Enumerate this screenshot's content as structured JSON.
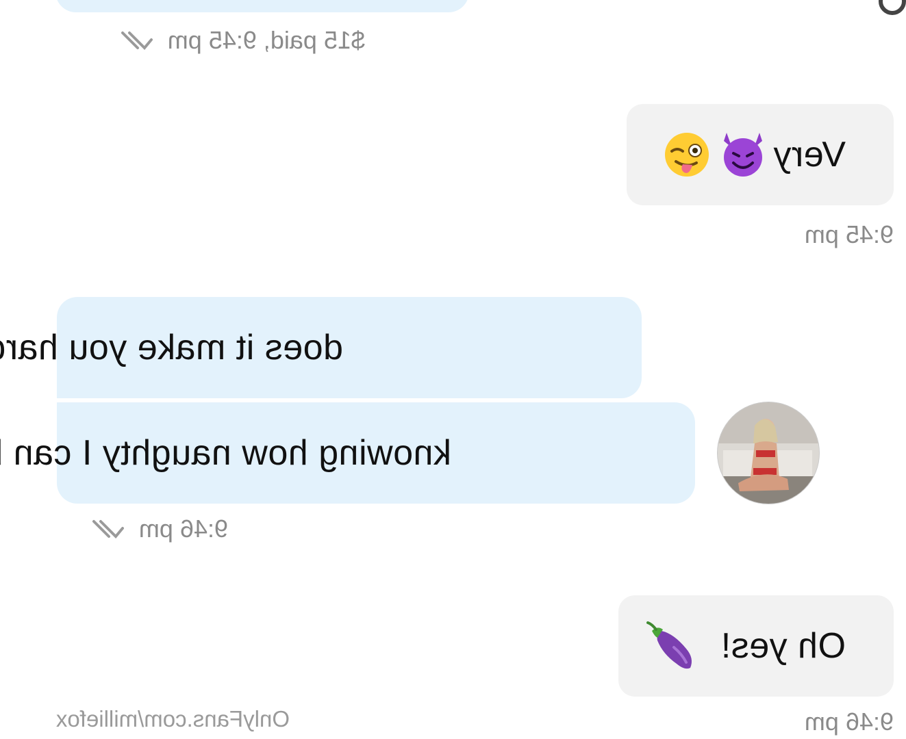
{
  "colors": {
    "incoming_bubble": "#e3f2fc",
    "outgoing_bubble": "#f2f2f2",
    "meta_text": "#8a8a8a"
  },
  "messages": [
    {
      "direction": "incoming",
      "text": "",
      "meta": "$15 paid, 9:45 pm",
      "read_icon": "double-check-icon"
    },
    {
      "direction": "outgoing",
      "text": "Very",
      "emojis": [
        "smiling-devil-emoji",
        "winking-tongue-emoji"
      ],
      "meta": "9:45 pm"
    },
    {
      "direction": "incoming",
      "text": "does it make you hard baby"
    },
    {
      "direction": "incoming",
      "text": "knowing how naughty I can be",
      "meta": "9:46 pm",
      "read_icon": "double-check-icon",
      "avatar": "user-avatar-photo"
    },
    {
      "direction": "outgoing",
      "text": "Oh yes!",
      "emojis": [
        "eggplant-emoji"
      ],
      "meta": "9:46 pm"
    }
  ],
  "watermark": "OnlyFans.com/milliefox"
}
